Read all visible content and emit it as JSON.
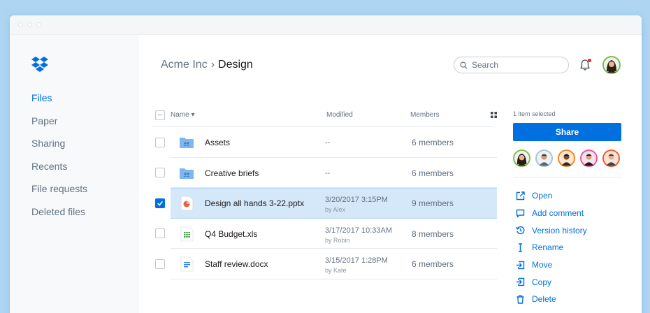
{
  "sidebar": {
    "items": [
      {
        "label": "Files",
        "active": true
      },
      {
        "label": "Paper",
        "active": false
      },
      {
        "label": "Sharing",
        "active": false
      },
      {
        "label": "Recents",
        "active": false
      },
      {
        "label": "File requests",
        "active": false
      },
      {
        "label": "Deleted files",
        "active": false
      }
    ]
  },
  "header": {
    "breadcrumb": {
      "parent": "Acme Inc",
      "separator": "›",
      "current": "Design"
    },
    "search_placeholder": "Search"
  },
  "table": {
    "columns": {
      "name": "Name",
      "sort_indicator": "▾",
      "modified": "Modified",
      "members": "Members"
    },
    "rows": [
      {
        "name": "Assets",
        "icon": "shared-folder-icon",
        "modified": "--",
        "by": "",
        "members": "6 members",
        "selected": false
      },
      {
        "name": "Creative briefs",
        "icon": "shared-folder-icon",
        "modified": "--",
        "by": "",
        "members": "6 members",
        "selected": false
      },
      {
        "name": "Design all hands 3-22.pptx",
        "icon": "pptx-icon",
        "modified": "3/20/2017 3:15PM",
        "by": "by Alex",
        "members": "9 members",
        "selected": true
      },
      {
        "name": "Q4 Budget.xls",
        "icon": "xls-icon",
        "modified": "3/17/2017 10:33AM",
        "by": "by Robin",
        "members": "8 members",
        "selected": false
      },
      {
        "name": "Staff review.docx",
        "icon": "docx-icon",
        "modified": "3/15/2017 1:28PM",
        "by": "by Kate",
        "members": "6 members",
        "selected": false
      }
    ]
  },
  "panel": {
    "selected_count": "1 item selected",
    "share_label": "Share",
    "actions": [
      {
        "label": "Open",
        "icon": "open-external-icon"
      },
      {
        "label": "Add comment",
        "icon": "comment-icon"
      },
      {
        "label": "Version history",
        "icon": "history-icon"
      },
      {
        "label": "Rename",
        "icon": "text-cursor-icon"
      },
      {
        "label": "Move",
        "icon": "move-icon"
      },
      {
        "label": "Copy",
        "icon": "copy-icon"
      },
      {
        "label": "Delete",
        "icon": "trash-icon"
      }
    ]
  },
  "colors": {
    "accent": "#0070e0",
    "selected_row": "#d5e8fa",
    "folder": "#7eb6f0",
    "notification": "#e0312b",
    "member_rings": [
      "#7bbe4a",
      "#a8c3d8",
      "#f5851f",
      "#e3549b",
      "#f05a28"
    ]
  }
}
